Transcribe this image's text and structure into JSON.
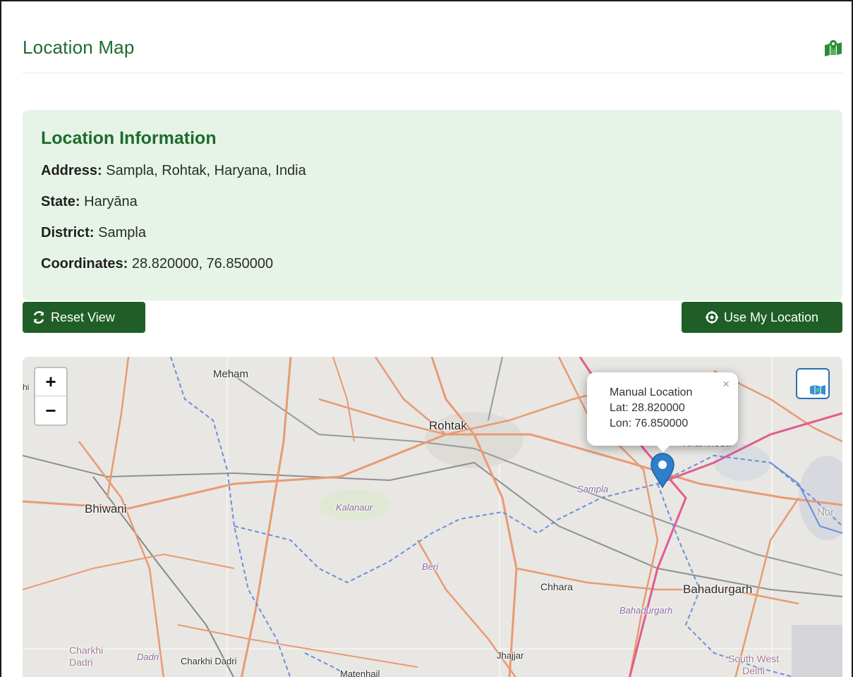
{
  "header": {
    "title": "Location Map",
    "icon": "map-location-icon",
    "accent": "#1f6b2c"
  },
  "info": {
    "title": "Location Information",
    "address_label": "Address:",
    "address": "Sampla, Rohtak, Haryana, India",
    "state_label": "State:",
    "state": "Haryāna",
    "district_label": "District:",
    "district": "Sampla",
    "coordinates_label": "Coordinates:",
    "coordinates": "28.820000, 76.850000",
    "background": "#e6f4e8"
  },
  "actions": {
    "reset_label": "Reset View",
    "reset_icon": "refresh-icon",
    "locate_label": "Use My Location",
    "locate_icon": "crosshair-icon",
    "button_color": "#1f5e26"
  },
  "map": {
    "zoom_in": "+",
    "zoom_out": "−",
    "layers_icon": "map-layers-icon",
    "marker_icon": "map-pin-icon",
    "popup": {
      "title": "Manual Location",
      "lat": "Lat: 28.820000",
      "lon": "Lon: 76.850000",
      "close": "×"
    },
    "places": {
      "meham": "Meham",
      "rohtak": "Rohtak",
      "kharkhoda": "Kharkhoda",
      "sampla": "Sampla",
      "bhiwani": "Bhiwani",
      "kalanaur": "Kalanaur",
      "beri": "Beri",
      "chhara": "Chhara",
      "bahadurgarh": "Bahadurgarh",
      "bahadurgarh_district": "Bahadurgarh",
      "charkhi_dadri_district": "Charkhi\nDadri",
      "dadri": "Dadri",
      "charkhi_dadri": "Charkhi Dadri",
      "matenhail": "Matenhail",
      "jhajjar": "Jhajjar",
      "south_west_delhi": "South West\nDelhi",
      "nor": "Nor",
      "hi": "hi"
    }
  }
}
